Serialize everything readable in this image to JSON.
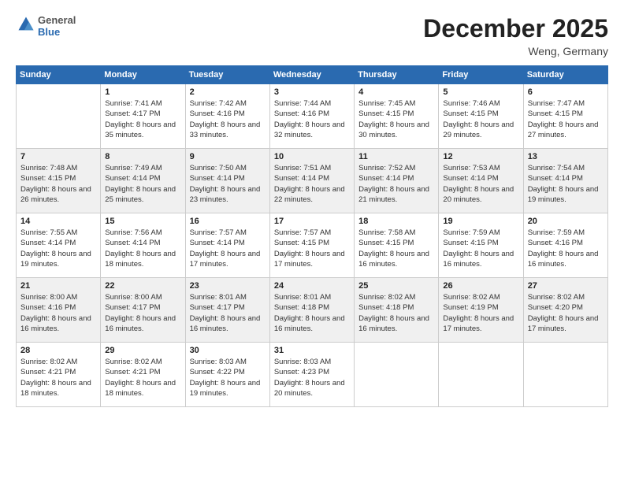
{
  "header": {
    "logo": {
      "general": "General",
      "blue": "Blue"
    },
    "title": "December 2025",
    "location": "Weng, Germany"
  },
  "weekdays": [
    "Sunday",
    "Monday",
    "Tuesday",
    "Wednesday",
    "Thursday",
    "Friday",
    "Saturday"
  ],
  "weeks": [
    [
      {
        "day": "",
        "sunrise": "",
        "sunset": "",
        "daylight": ""
      },
      {
        "day": "1",
        "sunrise": "Sunrise: 7:41 AM",
        "sunset": "Sunset: 4:17 PM",
        "daylight": "Daylight: 8 hours and 35 minutes."
      },
      {
        "day": "2",
        "sunrise": "Sunrise: 7:42 AM",
        "sunset": "Sunset: 4:16 PM",
        "daylight": "Daylight: 8 hours and 33 minutes."
      },
      {
        "day": "3",
        "sunrise": "Sunrise: 7:44 AM",
        "sunset": "Sunset: 4:16 PM",
        "daylight": "Daylight: 8 hours and 32 minutes."
      },
      {
        "day": "4",
        "sunrise": "Sunrise: 7:45 AM",
        "sunset": "Sunset: 4:15 PM",
        "daylight": "Daylight: 8 hours and 30 minutes."
      },
      {
        "day": "5",
        "sunrise": "Sunrise: 7:46 AM",
        "sunset": "Sunset: 4:15 PM",
        "daylight": "Daylight: 8 hours and 29 minutes."
      },
      {
        "day": "6",
        "sunrise": "Sunrise: 7:47 AM",
        "sunset": "Sunset: 4:15 PM",
        "daylight": "Daylight: 8 hours and 27 minutes."
      }
    ],
    [
      {
        "day": "7",
        "sunrise": "Sunrise: 7:48 AM",
        "sunset": "Sunset: 4:15 PM",
        "daylight": "Daylight: 8 hours and 26 minutes."
      },
      {
        "day": "8",
        "sunrise": "Sunrise: 7:49 AM",
        "sunset": "Sunset: 4:14 PM",
        "daylight": "Daylight: 8 hours and 25 minutes."
      },
      {
        "day": "9",
        "sunrise": "Sunrise: 7:50 AM",
        "sunset": "Sunset: 4:14 PM",
        "daylight": "Daylight: 8 hours and 23 minutes."
      },
      {
        "day": "10",
        "sunrise": "Sunrise: 7:51 AM",
        "sunset": "Sunset: 4:14 PM",
        "daylight": "Daylight: 8 hours and 22 minutes."
      },
      {
        "day": "11",
        "sunrise": "Sunrise: 7:52 AM",
        "sunset": "Sunset: 4:14 PM",
        "daylight": "Daylight: 8 hours and 21 minutes."
      },
      {
        "day": "12",
        "sunrise": "Sunrise: 7:53 AM",
        "sunset": "Sunset: 4:14 PM",
        "daylight": "Daylight: 8 hours and 20 minutes."
      },
      {
        "day": "13",
        "sunrise": "Sunrise: 7:54 AM",
        "sunset": "Sunset: 4:14 PM",
        "daylight": "Daylight: 8 hours and 19 minutes."
      }
    ],
    [
      {
        "day": "14",
        "sunrise": "Sunrise: 7:55 AM",
        "sunset": "Sunset: 4:14 PM",
        "daylight": "Daylight: 8 hours and 19 minutes."
      },
      {
        "day": "15",
        "sunrise": "Sunrise: 7:56 AM",
        "sunset": "Sunset: 4:14 PM",
        "daylight": "Daylight: 8 hours and 18 minutes."
      },
      {
        "day": "16",
        "sunrise": "Sunrise: 7:57 AM",
        "sunset": "Sunset: 4:14 PM",
        "daylight": "Daylight: 8 hours and 17 minutes."
      },
      {
        "day": "17",
        "sunrise": "Sunrise: 7:57 AM",
        "sunset": "Sunset: 4:15 PM",
        "daylight": "Daylight: 8 hours and 17 minutes."
      },
      {
        "day": "18",
        "sunrise": "Sunrise: 7:58 AM",
        "sunset": "Sunset: 4:15 PM",
        "daylight": "Daylight: 8 hours and 16 minutes."
      },
      {
        "day": "19",
        "sunrise": "Sunrise: 7:59 AM",
        "sunset": "Sunset: 4:15 PM",
        "daylight": "Daylight: 8 hours and 16 minutes."
      },
      {
        "day": "20",
        "sunrise": "Sunrise: 7:59 AM",
        "sunset": "Sunset: 4:16 PM",
        "daylight": "Daylight: 8 hours and 16 minutes."
      }
    ],
    [
      {
        "day": "21",
        "sunrise": "Sunrise: 8:00 AM",
        "sunset": "Sunset: 4:16 PM",
        "daylight": "Daylight: 8 hours and 16 minutes."
      },
      {
        "day": "22",
        "sunrise": "Sunrise: 8:00 AM",
        "sunset": "Sunset: 4:17 PM",
        "daylight": "Daylight: 8 hours and 16 minutes."
      },
      {
        "day": "23",
        "sunrise": "Sunrise: 8:01 AM",
        "sunset": "Sunset: 4:17 PM",
        "daylight": "Daylight: 8 hours and 16 minutes."
      },
      {
        "day": "24",
        "sunrise": "Sunrise: 8:01 AM",
        "sunset": "Sunset: 4:18 PM",
        "daylight": "Daylight: 8 hours and 16 minutes."
      },
      {
        "day": "25",
        "sunrise": "Sunrise: 8:02 AM",
        "sunset": "Sunset: 4:18 PM",
        "daylight": "Daylight: 8 hours and 16 minutes."
      },
      {
        "day": "26",
        "sunrise": "Sunrise: 8:02 AM",
        "sunset": "Sunset: 4:19 PM",
        "daylight": "Daylight: 8 hours and 17 minutes."
      },
      {
        "day": "27",
        "sunrise": "Sunrise: 8:02 AM",
        "sunset": "Sunset: 4:20 PM",
        "daylight": "Daylight: 8 hours and 17 minutes."
      }
    ],
    [
      {
        "day": "28",
        "sunrise": "Sunrise: 8:02 AM",
        "sunset": "Sunset: 4:21 PM",
        "daylight": "Daylight: 8 hours and 18 minutes."
      },
      {
        "day": "29",
        "sunrise": "Sunrise: 8:02 AM",
        "sunset": "Sunset: 4:21 PM",
        "daylight": "Daylight: 8 hours and 18 minutes."
      },
      {
        "day": "30",
        "sunrise": "Sunrise: 8:03 AM",
        "sunset": "Sunset: 4:22 PM",
        "daylight": "Daylight: 8 hours and 19 minutes."
      },
      {
        "day": "31",
        "sunrise": "Sunrise: 8:03 AM",
        "sunset": "Sunset: 4:23 PM",
        "daylight": "Daylight: 8 hours and 20 minutes."
      },
      {
        "day": "",
        "sunrise": "",
        "sunset": "",
        "daylight": ""
      },
      {
        "day": "",
        "sunrise": "",
        "sunset": "",
        "daylight": ""
      },
      {
        "day": "",
        "sunrise": "",
        "sunset": "",
        "daylight": ""
      }
    ]
  ]
}
